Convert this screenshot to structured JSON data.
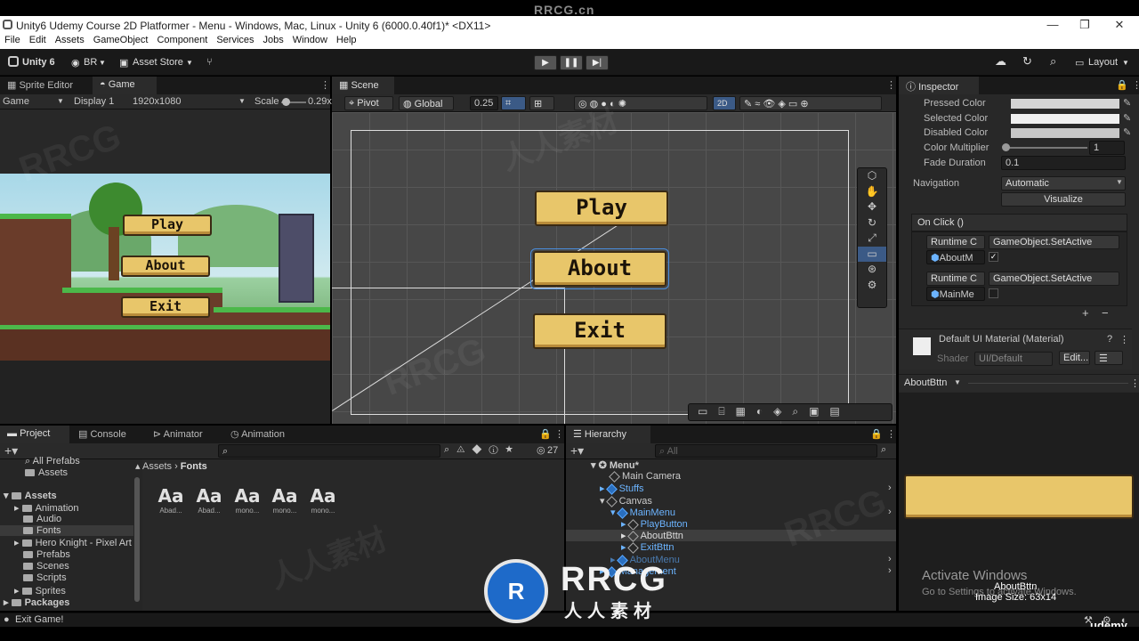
{
  "watermark": {
    "top": "RRCG.cn",
    "logo_main": "RRCG",
    "logo_sub": "人人素材",
    "tile": "RRCG",
    "tile_cn": "人人素材"
  },
  "window": {
    "title": "Unity6 Udemy Course 2D Platformer - Menu - Windows, Mac, Linux - Unity 6 (6000.0.40f1)* <DX11>",
    "min": "—",
    "max": "❐",
    "close": "✕"
  },
  "menu": [
    "File",
    "Edit",
    "Assets",
    "GameObject",
    "Component",
    "Services",
    "Jobs",
    "Window",
    "Help"
  ],
  "toolbar": {
    "unity": "Unity 6",
    "account": "BR",
    "asset_store": "Asset Store",
    "layout": "Layout"
  },
  "game_panel": {
    "tabs": [
      "Sprite Editor",
      "Game"
    ],
    "display_mode": "Game",
    "display": "Display 1",
    "resolution": "1920x1080",
    "scale_label": "Scale",
    "scale_value": "0.29x",
    "buttons": [
      "Play",
      "About",
      "Exit"
    ]
  },
  "scene_panel": {
    "tab": "Scene",
    "pivot": "Pivot",
    "global": "Global",
    "snap": "0.25",
    "mode2d": "2D",
    "buttons": [
      "Play",
      "About",
      "Exit"
    ]
  },
  "inspector": {
    "tab": "Inspector",
    "pressed": "Pressed Color",
    "selected": "Selected Color",
    "disabled": "Disabled Color",
    "multiplier": "Color Multiplier",
    "multiplier_value": "1",
    "fade": "Fade Duration",
    "fade_value": "0.1",
    "navigation": "Navigation",
    "navigation_value": "Automatic",
    "visualize": "Visualize",
    "onclick": "On Click ()",
    "events": [
      {
        "mode": "Runtime C",
        "func": "GameObject.SetActive",
        "obj": "AboutM",
        "checked": true
      },
      {
        "mode": "Runtime C",
        "func": "GameObject.SetActive",
        "obj": "MainMe",
        "checked": false
      }
    ],
    "add": "+",
    "remove": "−",
    "material": "Default UI Material (Material)",
    "shader_label": "Shader",
    "shader": "UI/Default",
    "edit": "Edit...",
    "preview_name": "AboutBttn",
    "preview_title": "AboutBttn",
    "image_size": "Image Size: 63x14",
    "activate": "Activate Windows",
    "activate_sub": "Go to Settings to activate Windows."
  },
  "project": {
    "tabs": [
      "Project",
      "Console",
      "Animator",
      "Animation"
    ],
    "count": "27",
    "tree": [
      "All Prefabs",
      "Assets",
      "Assets",
      "Animation",
      "Audio",
      "Fonts",
      "Hero Knight - Pixel Art",
      "Prefabs",
      "Scenes",
      "Scripts",
      "Sprites",
      "Packages"
    ],
    "breadcrumb": [
      "Assets",
      "Fonts"
    ],
    "fonts": [
      {
        "glyph": "Aa",
        "name": "Abad..."
      },
      {
        "glyph": "Aa",
        "name": "Abad..."
      },
      {
        "glyph": "Aa",
        "name": "mono..."
      },
      {
        "glyph": "Aa",
        "name": "mono..."
      },
      {
        "glyph": "Aa",
        "name": "mono..."
      }
    ]
  },
  "hierarchy": {
    "tab": "Hierarchy",
    "search": "All",
    "items": [
      "Menu*",
      "Main Camera",
      "Stuffs",
      "Canvas",
      "MainMenu",
      "PlayButton",
      "AboutBttn",
      "ExitBttn",
      "AboutMenu",
      "Management"
    ]
  },
  "status": {
    "text": "Exit Game!",
    "brand": "udemy"
  }
}
